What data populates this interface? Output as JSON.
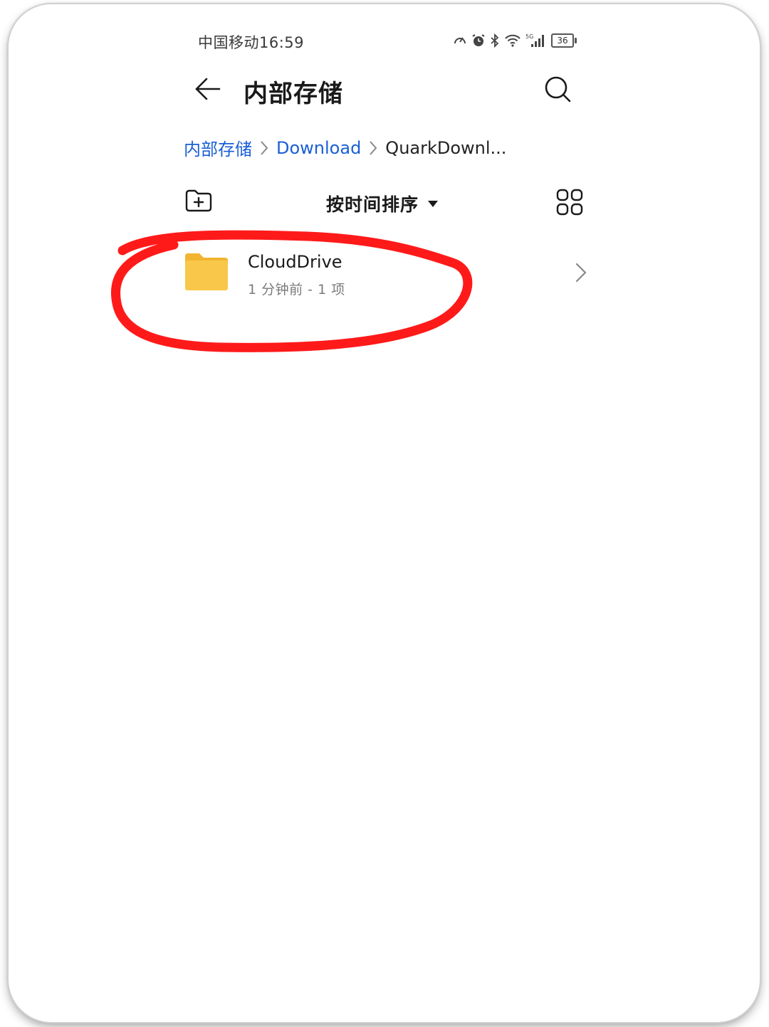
{
  "status_bar": {
    "carrier": "中国移动",
    "time": "16:59",
    "network": "5G",
    "battery": "36"
  },
  "header": {
    "title": "内部存储"
  },
  "breadcrumb": {
    "items": [
      "内部存储",
      "Download",
      "QuarkDownl..."
    ]
  },
  "toolbar": {
    "sort_label": "按时间排序"
  },
  "files": [
    {
      "name": "CloudDrive",
      "meta": "1 分钟前 - 1 项"
    }
  ],
  "colors": {
    "link": "#1a5fd6",
    "folder": "#f7c544",
    "annotation": "#ff1a1a"
  },
  "icons": [
    "back-arrow-icon",
    "search-icon",
    "chevron-right-icon",
    "new-folder-icon",
    "sort-dropdown-icon",
    "grid-view-icon",
    "folder-icon"
  ]
}
